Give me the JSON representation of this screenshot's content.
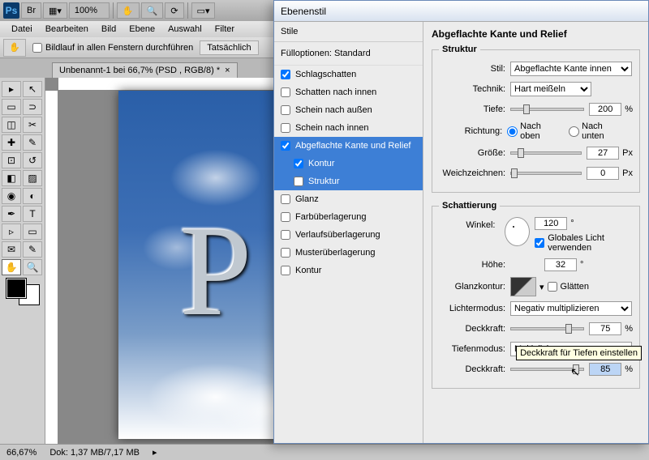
{
  "app": {
    "zoom_combo": "100%"
  },
  "menu": [
    "Datei",
    "Bearbeiten",
    "Bild",
    "Ebene",
    "Auswahl",
    "Filter"
  ],
  "options": {
    "scroll_all": "Bildlauf in allen Fenstern durchführen",
    "actual": "Tatsächlich"
  },
  "doc": {
    "tab": "Unbenannt-1 bei 66,7% (PSD     , RGB/8) *"
  },
  "canvas": {
    "letter": "P"
  },
  "status": {
    "zoom": "66,67%",
    "doc_size": "Dok: 1,37 MB/7,17 MB"
  },
  "dialog": {
    "title": "Ebenenstil",
    "styles_head": "Stile",
    "fill_options": "Fülloptionen: Standard",
    "styles": [
      {
        "label": "Schlagschatten",
        "checked": true,
        "sel": false
      },
      {
        "label": "Schatten nach innen",
        "checked": false,
        "sel": false
      },
      {
        "label": "Schein nach außen",
        "checked": false,
        "sel": false
      },
      {
        "label": "Schein nach innen",
        "checked": false,
        "sel": false
      },
      {
        "label": "Abgeflachte Kante und Relief",
        "checked": true,
        "sel": true
      },
      {
        "label": "Kontur",
        "checked": true,
        "sel": true,
        "indent": true
      },
      {
        "label": "Struktur",
        "checked": false,
        "sel": true,
        "indent": true
      },
      {
        "label": "Glanz",
        "checked": false,
        "sel": false
      },
      {
        "label": "Farbüberlagerung",
        "checked": false,
        "sel": false
      },
      {
        "label": "Verlaufsüberlagerung",
        "checked": false,
        "sel": false
      },
      {
        "label": "Musterüberlagerung",
        "checked": false,
        "sel": false
      },
      {
        "label": "Kontur",
        "checked": false,
        "sel": false
      }
    ],
    "panel_title": "Abgeflachte Kante und Relief",
    "struktur": {
      "legend": "Struktur",
      "stil_lbl": "Stil:",
      "stil_val": "Abgeflachte Kante innen",
      "technik_lbl": "Technik:",
      "technik_val": "Hart meißeln",
      "tiefe_lbl": "Tiefe:",
      "tiefe_val": "200",
      "tiefe_unit": "%",
      "richtung_lbl": "Richtung:",
      "richtung_up": "Nach oben",
      "richtung_down": "Nach unten",
      "groesse_lbl": "Größe:",
      "groesse_val": "27",
      "groesse_unit": "Px",
      "weich_lbl": "Weichzeichnen:",
      "weich_val": "0",
      "weich_unit": "Px"
    },
    "schattierung": {
      "legend": "Schattierung",
      "winkel_lbl": "Winkel:",
      "winkel_val": "120",
      "winkel_unit": "°",
      "global_light": "Globales Licht verwenden",
      "hoehe_lbl": "Höhe:",
      "hoehe_val": "32",
      "hoehe_unit": "°",
      "glanz_lbl": "Glanzkontur:",
      "glaetten": "Glätten",
      "lichter_lbl": "Lichtermodus:",
      "lichter_val": "Negativ multiplizieren",
      "deck1_lbl": "Deckkraft:",
      "deck1_val": "75",
      "deck1_unit": "%",
      "tiefen_lbl": "Tiefenmodus:",
      "tiefen_val": "Multiplizieren",
      "deck2_lbl": "Deckkraft:",
      "deck2_val": "85",
      "deck2_unit": "%"
    },
    "tooltip": "Deckkraft für Tiefen einstellen"
  }
}
